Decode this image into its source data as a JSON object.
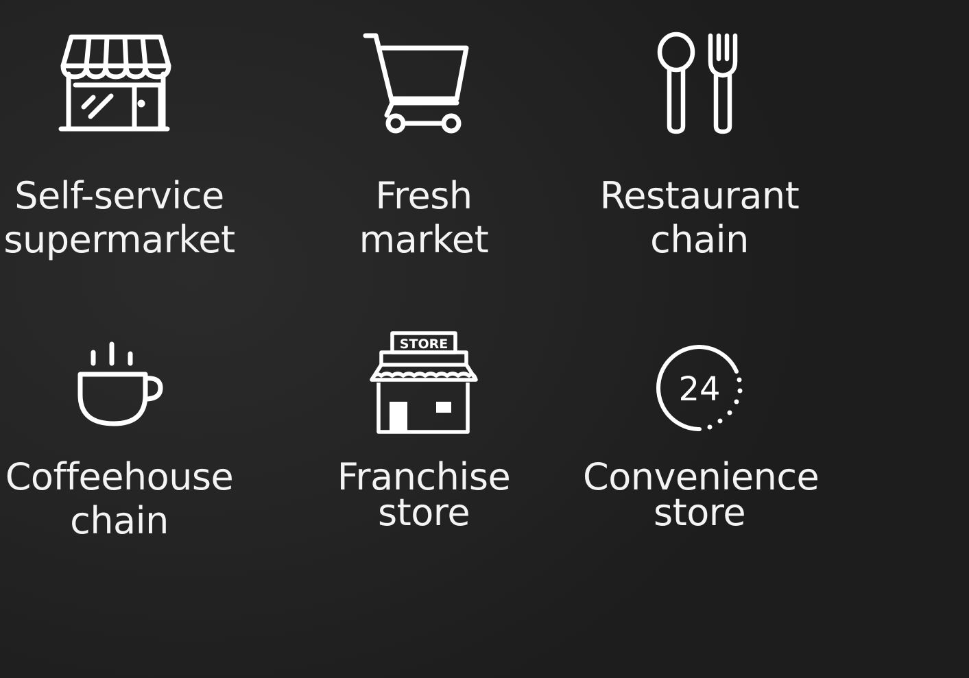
{
  "colors": {
    "background": "#242424",
    "foreground": "#ffffff"
  },
  "tiles": [
    {
      "icon": "storefront-icon",
      "line1": "Self-service",
      "line2": "supermarket"
    },
    {
      "icon": "shopping-cart-icon",
      "line1": "Fresh",
      "line2": "market"
    },
    {
      "icon": "spoon-fork-icon",
      "line1": "Restaurant",
      "line2": "chain"
    },
    {
      "icon": "coffee-cup-icon",
      "line1": "Coffeehouse",
      "line2": "chain"
    },
    {
      "icon": "store-building-icon",
      "icon_text": "STORE",
      "line1": "Franchise",
      "line2": "store"
    },
    {
      "icon": "clock-24-icon",
      "icon_text": "24",
      "line1": "Convenience",
      "line2": "store"
    }
  ]
}
